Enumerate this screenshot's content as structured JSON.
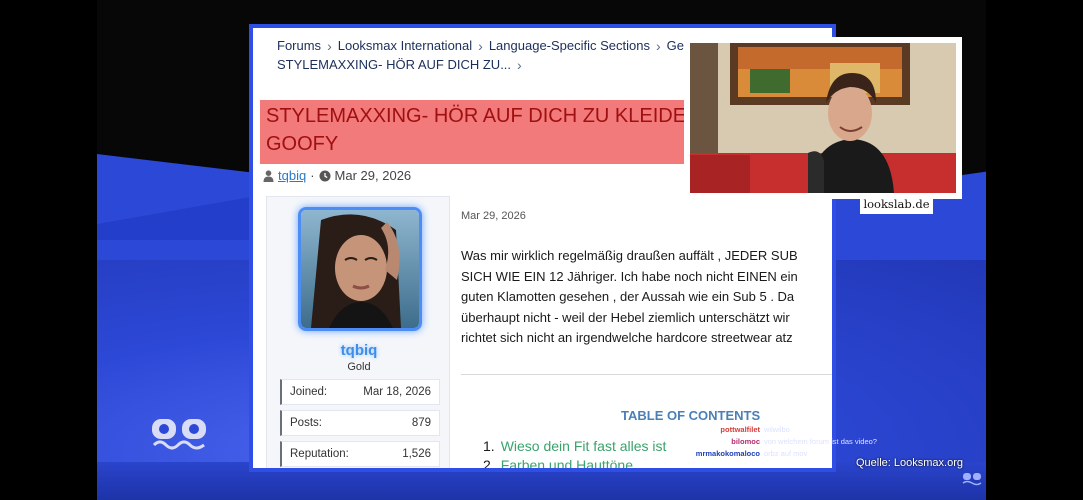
{
  "breadcrumbs": {
    "row1": [
      "Forums",
      "Looksmax International",
      "Language-Specific Sections",
      "German/Deutsch"
    ],
    "row2": "STYLEMAXXING- HÖR AUF DICH ZU..."
  },
  "thread": {
    "title": "STYLEMAXXING- HÖR AUF DICH ZU KLEIDEN WIE EIN GOOFY",
    "title_line1": "STYLEMAXXING- HÖR AUF DICH ZU KLEIDEN WIE EIN",
    "title_line2": "GOOFY",
    "author": "tqbiq",
    "date": "Mar 29, 2026"
  },
  "user_card": {
    "username": "tqbiq",
    "role": "Gold",
    "stats": [
      {
        "label": "Joined:",
        "value": "Mar 18, 2026"
      },
      {
        "label": "Posts:",
        "value": "879"
      },
      {
        "label": "Reputation:",
        "value": "1,526"
      }
    ]
  },
  "post": {
    "date": "Mar 29, 2026",
    "lines": [
      "Was mir wirklich regelmäßig draußen auffält , JEDER SUB",
      "SICH WIE EIN 12 Jähriger. Ich habe noch nicht EINEN ein",
      "guten Klamotten gesehen , der Aussah wie ein Sub 5 . Da",
      "überhaupt nicht - weil der Hebel ziemlich unterschätzt wir",
      "richtet sich nicht an irgendwelche hardcore streetwear atz"
    ],
    "toc_title": "TABLE OF CONTENTS",
    "toc_items": [
      {
        "n": "1.",
        "text": "Wieso dein Fit fast alles ist"
      },
      {
        "n": "2.",
        "text": "Farben und Hauttöne"
      }
    ]
  },
  "webcam": {
    "label": "lookslab.de"
  },
  "chat": [
    {
      "name": "pottwalfilet",
      "color": "#d93a3a",
      "msg": "wilwilbo"
    },
    {
      "name": "bilomoc",
      "color": "#b32b74",
      "msg": "von welchem forum ist das video?"
    },
    {
      "name": "mrmakokomaloco",
      "color": "#1d3fb8",
      "msg": "orbz auf mov"
    }
  ],
  "overlay": {
    "source": "Quelle: Looksmax.org"
  },
  "colors": {
    "frame_border": "#2f4ee6",
    "title_bg": "#f37a7a",
    "title_text": "#a01010",
    "link": "#2b79c9",
    "toc": "#3aa36b"
  }
}
